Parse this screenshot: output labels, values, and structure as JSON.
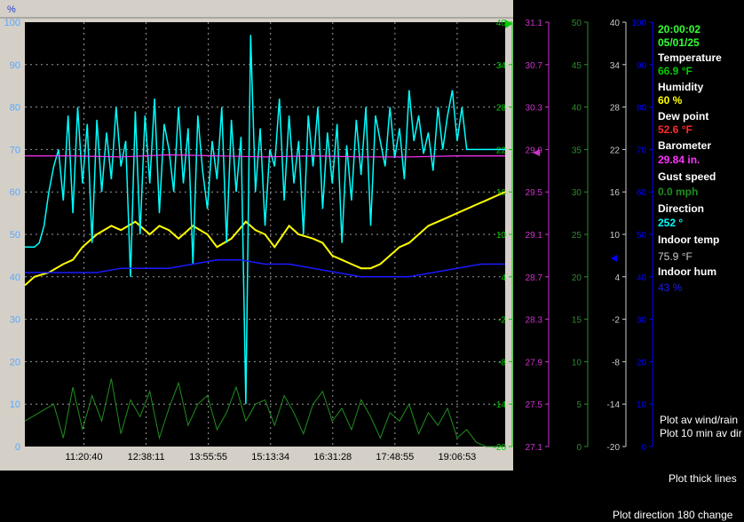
{
  "chart_data": {
    "type": "line",
    "title": "",
    "xlabel": "",
    "ylabel": "%",
    "x_ticks": [
      "11:20:40",
      "12:38:11",
      "13:55:55",
      "15:13:34",
      "16:31:28",
      "17:48:55",
      "19:06:53"
    ],
    "left_axis": {
      "unit": "%",
      "range": [
        0,
        100
      ],
      "ticks": [
        0,
        10,
        20,
        30,
        40,
        50,
        60,
        70,
        80,
        90,
        100
      ],
      "color": "#5aa6ff"
    },
    "right_axes": [
      {
        "name": "temperature",
        "color": "#00cc00",
        "range": [
          -20,
          40
        ],
        "ticks": [
          -20,
          -14,
          -8,
          -2,
          4,
          10,
          16,
          22,
          28,
          34,
          40
        ]
      },
      {
        "name": "barometer",
        "color": "#cc33cc",
        "range": [
          27.1,
          31.1
        ],
        "ticks": [
          27.1,
          27.5,
          27.9,
          28.3,
          28.7,
          29.1,
          29.5,
          29.9,
          30.3,
          30.7,
          31.1
        ]
      },
      {
        "name": "wind",
        "color": "#2e8b2e",
        "range": [
          0,
          50
        ],
        "ticks": [
          0,
          5,
          10,
          15,
          20,
          25,
          30,
          35,
          40,
          45,
          50
        ]
      },
      {
        "name": "indoor_temp",
        "color": "#cccccc",
        "range": [
          -20,
          40
        ],
        "ticks": [
          -20,
          -14,
          -8,
          -2,
          4,
          10,
          16,
          22,
          28,
          34,
          40
        ]
      },
      {
        "name": "indoor_hum",
        "color": "#0000ff",
        "range": [
          0,
          100
        ],
        "ticks": [
          0,
          10,
          20,
          30,
          40,
          50,
          60,
          70,
          80,
          90,
          100
        ]
      }
    ],
    "grid": true,
    "series": [
      {
        "key": "humidity",
        "color": "#ffff00",
        "width": 2,
        "axis": "%",
        "x": [
          0,
          0.02,
          0.05,
          0.08,
          0.1,
          0.12,
          0.15,
          0.18,
          0.2,
          0.23,
          0.26,
          0.28,
          0.3,
          0.32,
          0.35,
          0.38,
          0.4,
          0.43,
          0.46,
          0.48,
          0.5,
          0.52,
          0.55,
          0.57,
          0.6,
          0.62,
          0.64,
          0.66,
          0.68,
          0.7,
          0.72,
          0.74,
          0.76,
          0.78,
          0.8,
          0.82,
          0.84,
          0.86,
          0.88,
          0.9,
          0.92,
          0.94,
          0.96,
          0.98,
          1
        ],
        "values": [
          38,
          40,
          41,
          43,
          44,
          47,
          50,
          52,
          51,
          53,
          50,
          52,
          51,
          49,
          52,
          50,
          47,
          49,
          53,
          51,
          50,
          47,
          52,
          50,
          49,
          48,
          45,
          44,
          43,
          42,
          42,
          43,
          45,
          47,
          48,
          50,
          52,
          53,
          54,
          55,
          56,
          57,
          58,
          59,
          60
        ]
      },
      {
        "key": "dew_point",
        "color": "#00ffff",
        "width": 1.5,
        "axis": "%",
        "x": [
          0,
          0.02,
          0.03,
          0.04,
          0.05,
          0.06,
          0.07,
          0.08,
          0.09,
          0.1,
          0.11,
          0.12,
          0.13,
          0.14,
          0.15,
          0.16,
          0.17,
          0.18,
          0.19,
          0.2,
          0.21,
          0.22,
          0.23,
          0.24,
          0.25,
          0.26,
          0.27,
          0.28,
          0.29,
          0.3,
          0.31,
          0.32,
          0.33,
          0.34,
          0.35,
          0.36,
          0.37,
          0.38,
          0.39,
          0.4,
          0.41,
          0.42,
          0.43,
          0.44,
          0.45,
          0.46,
          0.47,
          0.48,
          0.49,
          0.5,
          0.51,
          0.52,
          0.53,
          0.54,
          0.55,
          0.56,
          0.57,
          0.58,
          0.59,
          0.6,
          0.61,
          0.62,
          0.63,
          0.64,
          0.65,
          0.66,
          0.67,
          0.68,
          0.69,
          0.7,
          0.71,
          0.72,
          0.73,
          0.74,
          0.75,
          0.76,
          0.77,
          0.78,
          0.79,
          0.8,
          0.81,
          0.82,
          0.83,
          0.84,
          0.85,
          0.86,
          0.87,
          0.88,
          0.89,
          0.9,
          0.91,
          0.92,
          0.93,
          0.94,
          1
        ],
        "values": [
          47,
          47,
          48,
          52,
          60,
          66,
          70,
          58,
          78,
          55,
          80,
          62,
          76,
          48,
          77,
          60,
          74,
          63,
          80,
          66,
          72,
          40,
          79,
          50,
          78,
          62,
          82,
          55,
          76,
          70,
          60,
          80,
          62,
          75,
          43,
          78,
          65,
          56,
          72,
          63,
          80,
          48,
          77,
          60,
          73,
          10,
          97,
          60,
          75,
          52,
          70,
          66,
          82,
          58,
          78,
          62,
          72,
          50,
          78,
          66,
          80,
          56,
          74,
          62,
          76,
          48,
          71,
          58,
          77,
          64,
          80,
          52,
          78,
          72,
          66,
          80,
          68,
          75,
          63,
          84,
          72,
          78,
          69,
          74,
          65,
          80,
          70,
          78,
          84,
          72,
          80,
          70,
          70,
          70,
          70
        ]
      },
      {
        "key": "barometer",
        "color": "#ff33ff",
        "width": 1.2,
        "axis": "barometer",
        "x": [
          0,
          0.1,
          0.2,
          0.3,
          0.4,
          0.5,
          0.6,
          0.7,
          0.8,
          0.9,
          1
        ],
        "values": [
          29.84,
          29.84,
          29.83,
          29.85,
          29.84,
          29.83,
          29.84,
          29.83,
          29.83,
          29.84,
          29.84
        ]
      },
      {
        "key": "indoor_hum",
        "color": "#1a1aff",
        "width": 1.5,
        "axis": "%",
        "x": [
          0,
          0.1,
          0.15,
          0.2,
          0.3,
          0.35,
          0.4,
          0.45,
          0.5,
          0.55,
          0.6,
          0.65,
          0.7,
          0.75,
          0.8,
          0.85,
          0.9,
          0.95,
          1
        ],
        "values": [
          41,
          41,
          41,
          42,
          42,
          43,
          44,
          44,
          43,
          43,
          42,
          41,
          40,
          40,
          40,
          41,
          42,
          43,
          43
        ]
      },
      {
        "key": "gust_speed",
        "color": "#1f8f1f",
        "width": 1,
        "axis": "%",
        "x": [
          0,
          0.03,
          0.06,
          0.08,
          0.1,
          0.12,
          0.14,
          0.16,
          0.18,
          0.2,
          0.22,
          0.24,
          0.26,
          0.28,
          0.3,
          0.32,
          0.34,
          0.36,
          0.38,
          0.4,
          0.42,
          0.44,
          0.46,
          0.48,
          0.5,
          0.52,
          0.54,
          0.56,
          0.58,
          0.6,
          0.62,
          0.64,
          0.66,
          0.68,
          0.7,
          0.72,
          0.74,
          0.76,
          0.78,
          0.8,
          0.82,
          0.84,
          0.86,
          0.88,
          0.9,
          0.92,
          0.94,
          0.96,
          1
        ],
        "values": [
          6,
          8,
          10,
          2,
          14,
          4,
          12,
          6,
          16,
          3,
          11,
          7,
          13,
          2,
          9,
          15,
          5,
          10,
          12,
          4,
          8,
          14,
          6,
          10,
          11,
          5,
          12,
          8,
          3,
          10,
          13,
          6,
          9,
          4,
          11,
          7,
          2,
          8,
          6,
          10,
          3,
          8,
          5,
          9,
          2,
          4,
          1,
          0,
          0
        ]
      }
    ]
  },
  "readout": {
    "time": "20:00:02",
    "date": "05/01/25",
    "temperature_label": "Temperature",
    "temperature_value": "66.9 °F",
    "humidity_label": "Humidity",
    "humidity_value": "60 %",
    "dewpoint_label": "Dew point",
    "dewpoint_value": "52.6 °F",
    "barometer_label": "Barometer",
    "barometer_value": "29.84 in.",
    "gust_label": "Gust speed",
    "gust_value": "0.0 mph",
    "direction_label": "Direction",
    "direction_value": "252 °",
    "indoor_temp_label": "Indoor temp",
    "indoor_temp_value": "75.9 °F",
    "indoor_hum_label": "Indoor hum",
    "indoor_hum_value": "43 %"
  },
  "options": {
    "plot_av_wind": "Plot av wind/rain",
    "plot_10min_dir": "Plot 10 min av dir",
    "plot_thick": "Plot thick lines",
    "plot_dir_change": "Plot direction 180 change"
  },
  "colors": {
    "white": "#ffffff",
    "time_green": "#33ff33",
    "temp_green": "#00cc00",
    "humidity_yellow": "#ffff00",
    "dewpoint_red": "#ff2a2a",
    "barometer_magenta": "#ff33ff",
    "gust_green": "#1f8f1f",
    "direction_cyan": "#00ffff",
    "indoor_gray": "#cccccc",
    "indoor_blue": "#1a1aff"
  }
}
